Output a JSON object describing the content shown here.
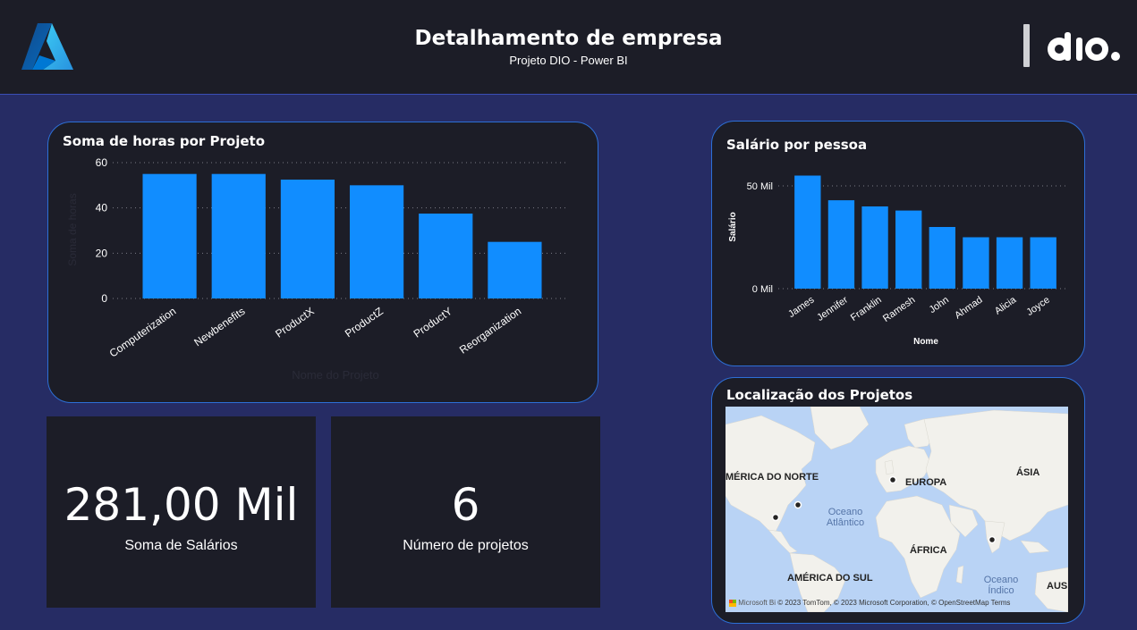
{
  "header": {
    "title": "Detalhamento de empresa",
    "subtitle": "Projeto DIO - Power BI",
    "logo_left": "azure-logo",
    "logo_right": "dio-logo"
  },
  "hours_chart": {
    "title": "Soma de horas por Projeto",
    "ylabel": "Soma de horas",
    "xlabel": "Nome do Projeto",
    "yticks": [
      "0",
      "20",
      "40",
      "60"
    ]
  },
  "salary_chart": {
    "title": "Salário por pessoa",
    "ylabel": "Salário",
    "xlabel": "Nome",
    "yticks": [
      "0 Mil",
      "50 Mil"
    ]
  },
  "kpis": {
    "salary_value": "281,00 Mil",
    "salary_label": "Soma de Salários",
    "projects_value": "6",
    "projects_label": "Número de projetos"
  },
  "map": {
    "title": "Localização dos Projetos",
    "labels": {
      "north_america": "MÉRICA DO NORTE",
      "europe": "EUROPA",
      "asia": "ÁSIA",
      "africa": "ÁFRICA",
      "south_america": "AMÉRICA DO SUL",
      "australia": "AUS",
      "atlantic": "Oceano Atlântico",
      "indian": "Oceano Índico"
    },
    "attribution_brand": "Microsoft Bi",
    "attribution": "© 2023 TomTom, © 2023 Microsoft Corporation, © OpenStreetMap  Terms"
  },
  "colors": {
    "background": "#262c64",
    "panel": "#1c1d27",
    "bar": "#118dff",
    "border": "#2d6fd6"
  },
  "chart_data": [
    {
      "type": "bar",
      "title": "Soma de horas por Projeto",
      "xlabel": "Nome do Projeto",
      "ylabel": "Soma de horas",
      "categories": [
        "Computerization",
        "Newbenefits",
        "ProductX",
        "ProductZ",
        "ProductY",
        "Reorganization"
      ],
      "values": [
        55,
        55,
        52.5,
        50,
        37.5,
        25
      ],
      "ylim": [
        0,
        60
      ],
      "grid": true
    },
    {
      "type": "bar",
      "title": "Salário por pessoa",
      "xlabel": "Nome",
      "ylabel": "Salário",
      "categories": [
        "James",
        "Jennifer",
        "Franklin",
        "Ramesh",
        "John",
        "Ahmad",
        "Alicia",
        "Joyce"
      ],
      "values": [
        55000,
        43000,
        40000,
        38000,
        30000,
        25000,
        25000,
        25000
      ],
      "ylim": [
        0,
        60000
      ],
      "grid": true
    }
  ]
}
